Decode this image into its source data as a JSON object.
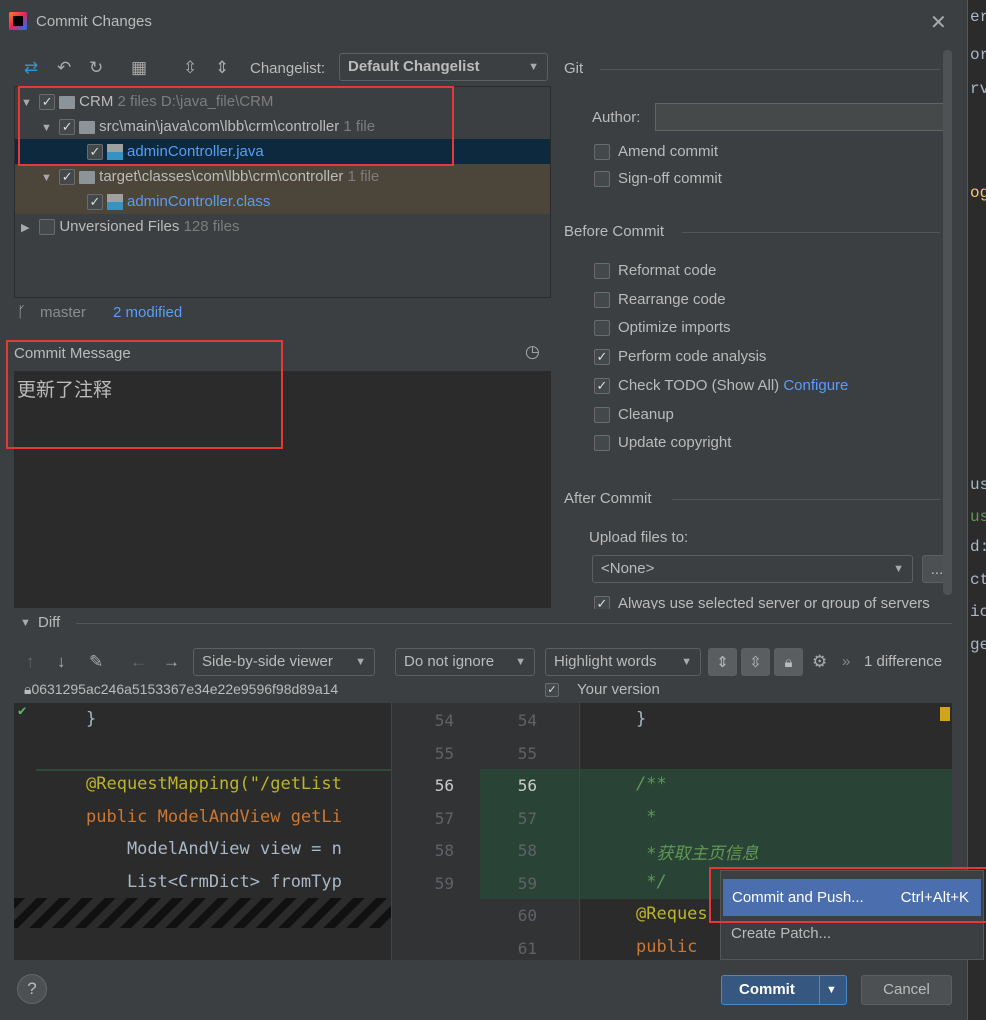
{
  "window": {
    "title": "Commit Changes"
  },
  "toolbar": {
    "changelist_label": "Changelist:",
    "changelist_value": "Default Changelist"
  },
  "tree": {
    "root": {
      "name": "CRM",
      "count": "2 files",
      "path": "D:\\java_file\\CRM"
    },
    "items": [
      {
        "name": "src\\main\\java\\com\\lbb\\crm\\controller",
        "count": "1 file"
      },
      {
        "name": "adminController.java"
      },
      {
        "name": "target\\classes\\com\\lbb\\crm\\controller",
        "count": "1 file"
      },
      {
        "name": "adminController.class"
      },
      {
        "name": "Unversioned Files",
        "count": "128 files"
      }
    ]
  },
  "status": {
    "branch": "master",
    "modified": "2 modified"
  },
  "commit_message": {
    "label": "Commit Message",
    "value": "更新了注释"
  },
  "git": {
    "section": "Git",
    "author_label": "Author:",
    "author_value": "",
    "amend": "Amend commit",
    "signoff": "Sign-off commit"
  },
  "before_commit": {
    "section": "Before Commit",
    "options": [
      {
        "label": "Reformat code",
        "checked": false
      },
      {
        "label": "Rearrange code",
        "checked": false
      },
      {
        "label": "Optimize imports",
        "checked": false
      },
      {
        "label": "Perform code analysis",
        "checked": true
      },
      {
        "label": "Check TODO (Show All)",
        "checked": true,
        "link": "Configure"
      },
      {
        "label": "Cleanup",
        "checked": false
      },
      {
        "label": "Update copyright",
        "checked": false
      }
    ]
  },
  "after_commit": {
    "section": "After Commit",
    "upload_label": "Upload files to:",
    "upload_value": "<None>",
    "more": "...",
    "always": "Always use selected server or group of servers"
  },
  "diff": {
    "section": "Diff",
    "viewer": "Side-by-side viewer",
    "ignore": "Do not ignore",
    "highlight": "Highlight words",
    "differences": "1 difference",
    "left_rev": "0631295ac246a5153367e34e22e9596f98d89a14",
    "right_label": "Your version",
    "left_lines": [
      "}",
      "",
      "@RequestMapping(\"/getList",
      "public ModelAndView getLi",
      "    ModelAndView view = n",
      "    List<CrmDict> fromTyp"
    ],
    "left_nums": [
      "54",
      "55",
      "56",
      "57",
      "58",
      "59"
    ],
    "right_nums": [
      "54",
      "55",
      "56",
      "57",
      "58",
      "59",
      "60",
      "61"
    ],
    "right_lines": [
      "}",
      "",
      "/**",
      " *",
      " *获取主页信息",
      " */",
      "@Reques",
      "public"
    ]
  },
  "popup": {
    "items": [
      {
        "label": "Commit and Push...",
        "shortcut": "Ctrl+Alt+K"
      },
      {
        "label": "Create Patch..."
      }
    ]
  },
  "buttons": {
    "help": "?",
    "commit": "Commit",
    "cancel": "Cancel"
  },
  "background_editor": [
    "er.j",
    "or",
    "rvi",
    "og",
    "us",
    "us",
    "d:",
    "ct",
    "ic",
    "ge"
  ],
  "colors": {
    "accent": "#4a88c7",
    "selection": "#0d293e",
    "highlight_red": "#e53935",
    "diff_insert": "#294436"
  }
}
